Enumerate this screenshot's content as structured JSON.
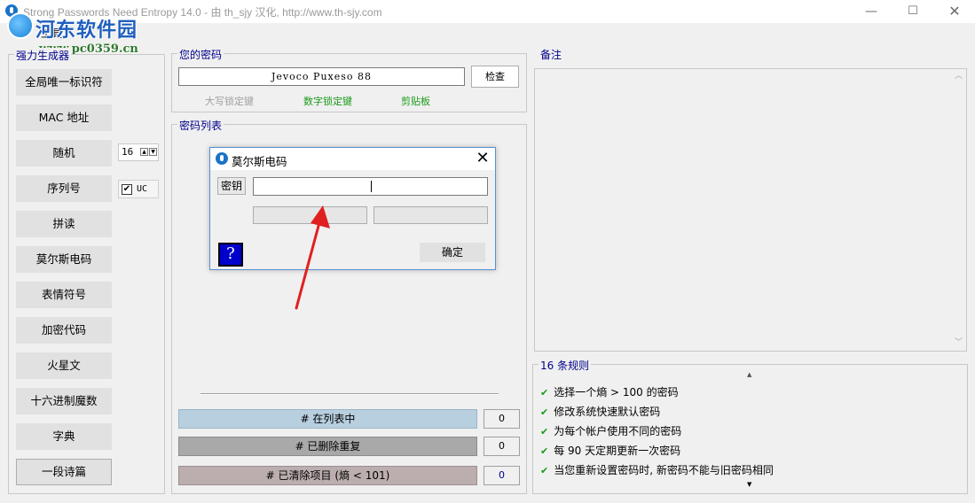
{
  "window": {
    "title": "Strong Passwords Need Entropy 14.0 - 由 th_sjy 汉化, http://www.th-sjy.com",
    "minimize_glyph": "—",
    "maximize_glyph": "☐",
    "close_glyph": "✕"
  },
  "watermark": {
    "title": "河东软件园",
    "url": "www.pc0359.cn"
  },
  "menu": {
    "items": [
      "工具"
    ]
  },
  "generator": {
    "group_label": "强力生成器",
    "buttons": [
      "全局唯一标识符",
      "MAC 地址",
      "随机",
      "序列号",
      "拼读",
      "莫尔斯电码",
      "表情符号",
      "加密代码",
      "火星文",
      "十六进制魔数",
      "字典",
      "一段诗篇"
    ],
    "random_length": "16",
    "uc_label": "UC",
    "uc_checked": true
  },
  "password": {
    "group_label": "您的密码",
    "value": "Jevoco Puxeso 88",
    "check_button": "检查",
    "capslock": "大写锁定键",
    "numlock": "数字锁定键",
    "clipboard": "剪贴板"
  },
  "list": {
    "group_label": "密码列表",
    "stats": [
      {
        "label": "# 在列表中",
        "value": "0"
      },
      {
        "label": "# 已删除重复",
        "value": "0"
      },
      {
        "label": "# 已清除项目 (熵 < 101)",
        "value": "0"
      }
    ]
  },
  "notes": {
    "group_label": "备注"
  },
  "rules": {
    "group_label": "16 条规则",
    "items": [
      "选择一个熵 > 100 的密码",
      "修改系统快速默认密码",
      "为每个帐户使用不同的密码",
      "每 90 天定期更新一次密码",
      "当您重新设置密码时, 新密码不能与旧密码相同"
    ]
  },
  "dialog": {
    "title": "莫尔斯电码",
    "key_label": "密钥",
    "key_value": "",
    "help_glyph": "?",
    "ok_button": "确定"
  },
  "colors": {
    "stat_list": "#b8cfe0",
    "stat_removed": "#a9a9a9",
    "stat_cleared": "#bcaeae",
    "rule_check": "#1a9a1a",
    "group_label": "#00008b",
    "annotation_arrow": "#e02020"
  },
  "icons": [
    "app-icon",
    "close-icon",
    "checkmark-icon",
    "help-icon",
    "arrow-annotation"
  ]
}
